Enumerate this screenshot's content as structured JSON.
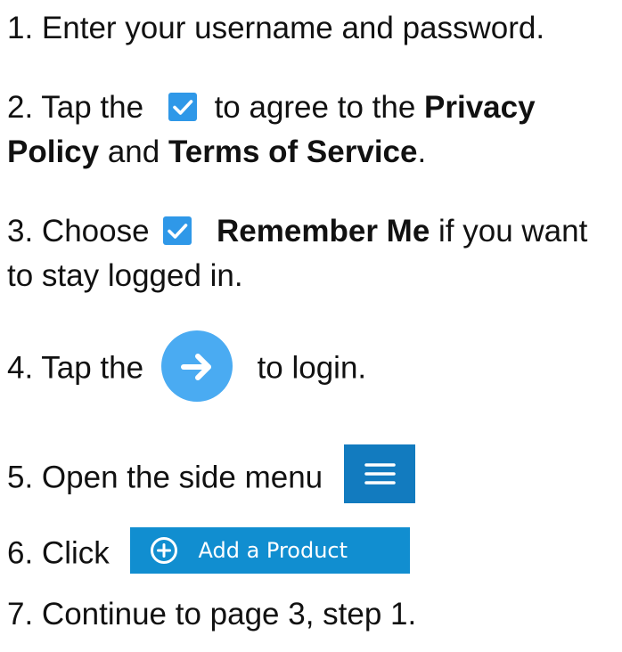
{
  "colors": {
    "checkbox": "#2f98e8",
    "arrow_circle": "#4aabf2",
    "menu_button": "#127bbf",
    "add_button": "#118ed0",
    "text": "#111111"
  },
  "steps": {
    "s1": {
      "text": "1. Enter your username and password."
    },
    "s2": {
      "prefix": "2. Tap the",
      "middle": "to agree to the",
      "bold1": "Privacy",
      "bold1b": "Policy",
      "and": "and",
      "bold2": "Terms of Service",
      "end": "."
    },
    "s3": {
      "prefix": "3. Choose",
      "bold": "Remember Me",
      "suffix": "if you want",
      "line2": "to stay logged in."
    },
    "s4": {
      "prefix": "4. Tap the",
      "suffix": "to login."
    },
    "s5": {
      "text": "5. Open the side menu"
    },
    "s6": {
      "prefix": "6. Click",
      "button_label": "Add a Product"
    },
    "s7": {
      "text": "7. Continue to page 3, step 1."
    }
  },
  "icons": {
    "checkbox": "checkbox-checked-icon",
    "arrow": "arrow-right-icon",
    "menu": "hamburger-menu-icon",
    "plus": "plus-circle-icon"
  }
}
